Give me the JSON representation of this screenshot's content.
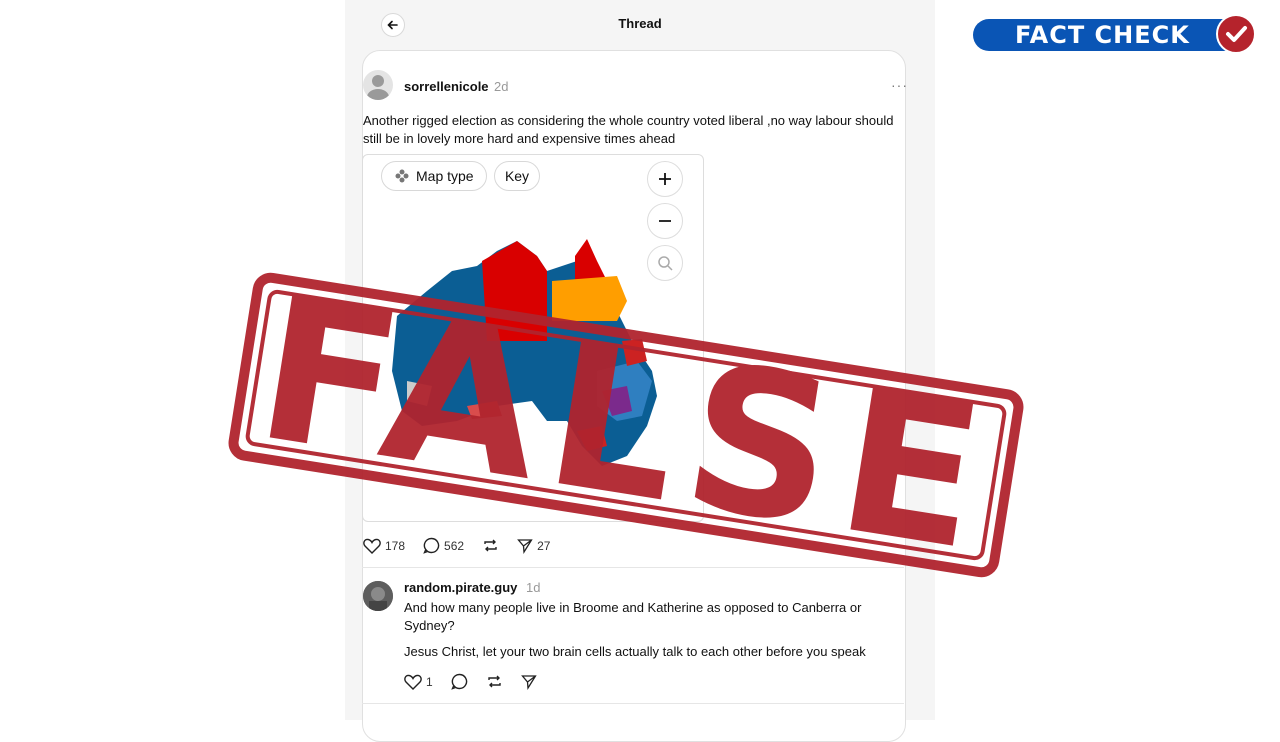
{
  "header": {
    "title": "Thread"
  },
  "post": {
    "username": "sorrellenicole",
    "time": "2d",
    "more": "···",
    "text_line1": "Another rigged election as considering the whole country voted liberal ,no way labour should",
    "text_line2": "still be in lovely more hard and expensive times ahead",
    "map": {
      "map_type_label": "Map type",
      "key_label": "Key"
    },
    "likes": "178",
    "comments": "562",
    "shares": "27"
  },
  "reply": {
    "username": "random.pirate.guy",
    "time": "1d",
    "text_line1": "And how many people live in Broome and Katherine as opposed to Canberra or",
    "text_line2": "Sydney?",
    "text_line3": "Jesus Christ, let your two brain cells actually talk to each other before you speak",
    "likes": "1"
  },
  "overlay": {
    "fact_check_label": "FACT CHECK",
    "stamp_text": "FALSE",
    "stamp_color": "#b0242e",
    "badge_color": "#0a55b5"
  }
}
